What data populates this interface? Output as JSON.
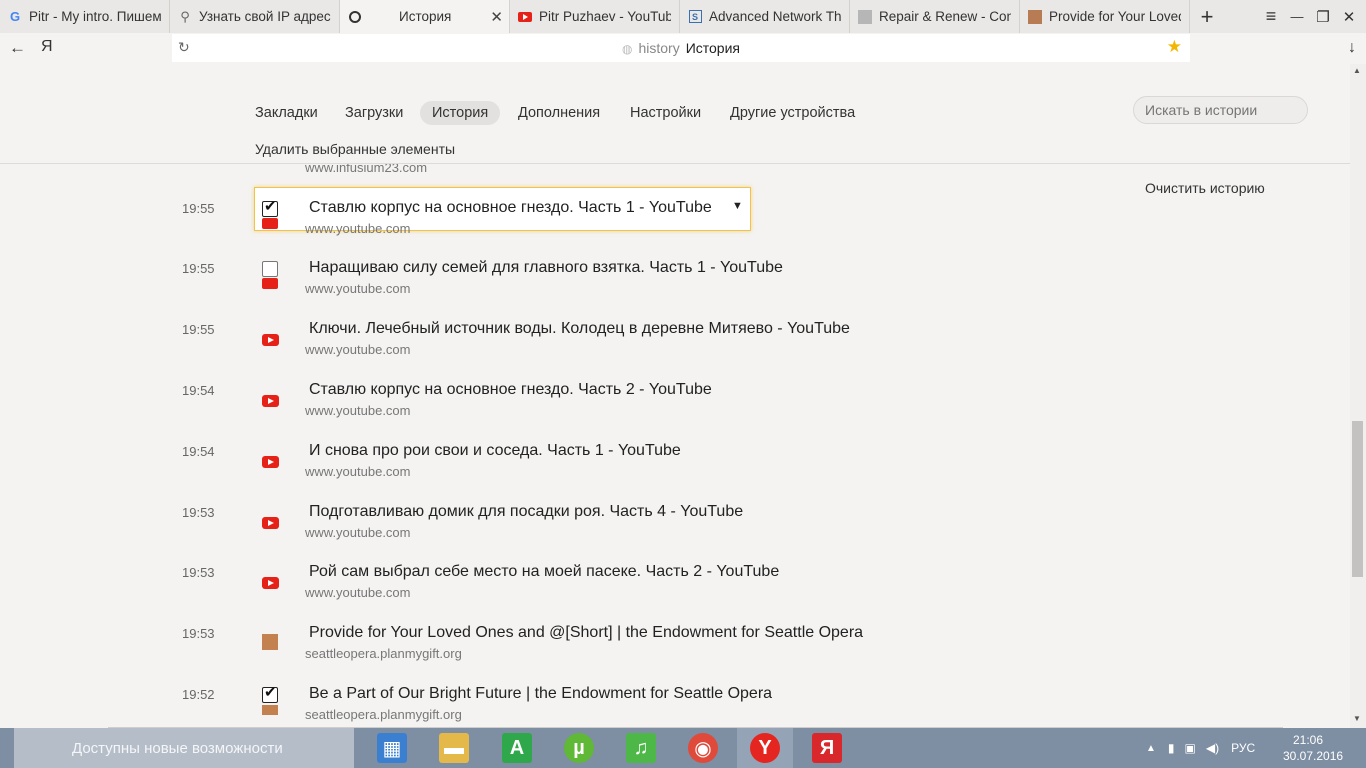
{
  "tabs": [
    {
      "label": "Pitr - My intro. Пишем",
      "icon": "google-icon",
      "active": false
    },
    {
      "label": "Узнать свой IP адрес",
      "icon": "search-icon",
      "active": false
    },
    {
      "label": "История",
      "icon": "clock-icon",
      "active": true
    },
    {
      "label": "Pitr Puzhaev - YouTube",
      "icon": "youtube-icon",
      "active": false
    },
    {
      "label": "Advanced Network Thr",
      "icon": "s-icon",
      "active": false
    },
    {
      "label": "Repair & Renew - Cond",
      "icon": "gray-square-icon",
      "active": false
    },
    {
      "label": "Provide for Your Loved",
      "icon": "brown-square-icon",
      "active": false
    }
  ],
  "tab_close": "✕",
  "new_tab": "+",
  "window": {
    "menu": "≡",
    "minimize": "—",
    "restore": "❐",
    "close": "✕"
  },
  "nav": {
    "back": "←",
    "yandex": "Я",
    "reload": "↻",
    "download": "↓"
  },
  "address": {
    "protocol": "history",
    "title": "История",
    "star": "★"
  },
  "page_nav": [
    {
      "label": "Закладки",
      "active": false
    },
    {
      "label": "Загрузки",
      "active": false
    },
    {
      "label": "История",
      "active": true
    },
    {
      "label": "Дополнения",
      "active": false
    },
    {
      "label": "Настройки",
      "active": false
    },
    {
      "label": "Другие устройства",
      "active": false
    }
  ],
  "search_placeholder": "Искать в истории",
  "delete_selected": "Удалить выбранные элементы",
  "clear_history": "Очистить историю",
  "prev_domain": "www.infusium23.com",
  "entries": [
    {
      "time": "19:55",
      "title": "Ставлю корпус на основное гнездо. Часть 1 - YouTube",
      "domain": "www.youtube.com",
      "icon": "youtube",
      "checkbox": "checked",
      "selected": true
    },
    {
      "time": "19:55",
      "title": "Наращиваю силу семей для главного взятка. Часть 1 - YouTube",
      "domain": "www.youtube.com",
      "icon": "youtube",
      "checkbox": "unchecked",
      "selected": false
    },
    {
      "time": "19:55",
      "title": "Ключи. Лечебный источник воды. Колодец в деревне Митяево - YouTube",
      "domain": "www.youtube.com",
      "icon": "youtube",
      "checkbox": "none",
      "selected": false
    },
    {
      "time": "19:54",
      "title": "Ставлю корпус на основное гнездо. Часть 2 - YouTube",
      "domain": "www.youtube.com",
      "icon": "youtube",
      "checkbox": "none",
      "selected": false
    },
    {
      "time": "19:54",
      "title": "И снова про рои свои и соседа. Часть 1 - YouTube",
      "domain": "www.youtube.com",
      "icon": "youtube",
      "checkbox": "none",
      "selected": false
    },
    {
      "time": "19:53",
      "title": "Подготавливаю домик для посадки роя. Часть 4 - YouTube",
      "domain": "www.youtube.com",
      "icon": "youtube",
      "checkbox": "none",
      "selected": false
    },
    {
      "time": "19:53",
      "title": "Рой сам выбрал себе место на моей пасеке. Часть 2 - YouTube",
      "domain": "www.youtube.com",
      "icon": "youtube",
      "checkbox": "none",
      "selected": false
    },
    {
      "time": "19:53",
      "title": "Provide for Your Loved Ones and @[Short] | the Endowment for Seattle Opera",
      "domain": "seattleopera.planmygift.org",
      "icon": "opera",
      "checkbox": "none",
      "selected": false
    },
    {
      "time": "19:52",
      "title": "Be a Part of Our Bright Future | the Endowment for Seattle Opera",
      "domain": "seattleopera.planmygift.org",
      "icon": "opera",
      "checkbox": "checked",
      "selected": false
    }
  ],
  "taskbar": {
    "search_text": "Доступны новые возможности",
    "apps": [
      {
        "name": "control-panel-icon",
        "glyph": "▦",
        "color": "#3b7fd1"
      },
      {
        "name": "file-explorer-icon",
        "glyph": "▬",
        "color": "#e5b84a"
      },
      {
        "name": "a-app-icon",
        "glyph": "A",
        "color": "#2ea84a"
      },
      {
        "name": "utorrent-icon",
        "glyph": "µ",
        "color": "#5fb836"
      },
      {
        "name": "music-app-icon",
        "glyph": "♫",
        "color": "#4db848"
      },
      {
        "name": "chrome-icon",
        "glyph": "◉",
        "color": "#e04a3b"
      },
      {
        "name": "yandex-browser-icon",
        "glyph": "Y",
        "color": "#e52620"
      },
      {
        "name": "yandex-app-icon",
        "glyph": "Я",
        "color": "#d8282b"
      }
    ],
    "lang": "РУС",
    "time": "21:06",
    "date": "30.07.2016"
  }
}
